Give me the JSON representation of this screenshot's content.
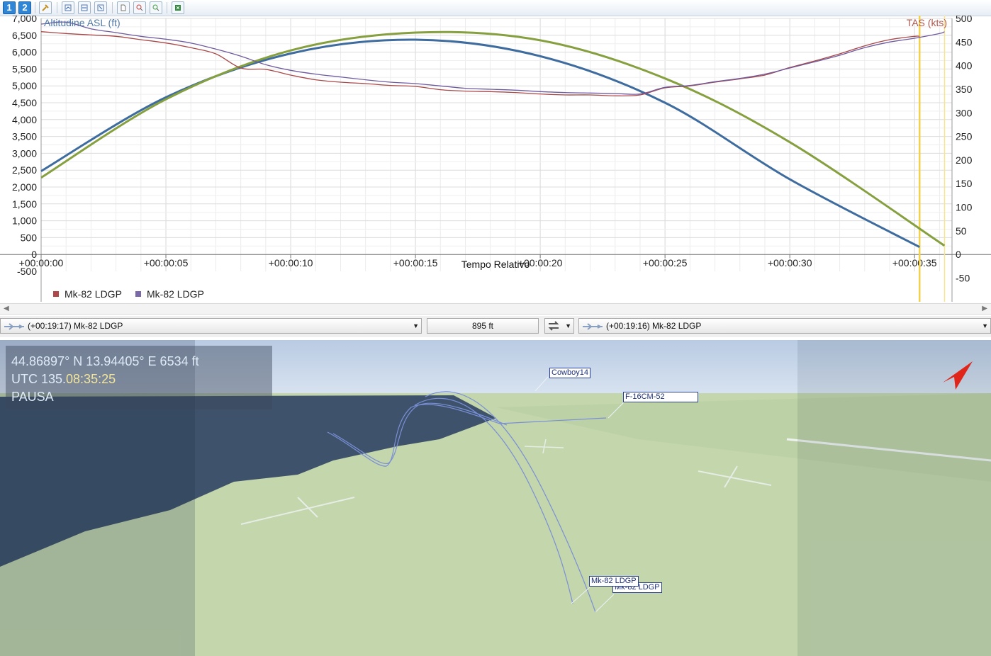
{
  "toolbar": {
    "tab1_label": "1",
    "tab2_label": "2",
    "icons": [
      "wrench-icon",
      "chart-add-icon",
      "chart-stack-icon",
      "chart-remove-icon",
      "new-page-icon",
      "zoom-out-icon",
      "zoom-in-icon",
      "export-excel-icon"
    ]
  },
  "chart": {
    "left_axis_title": "Altitudine ASL (ft)",
    "right_axis_title": "TAS (kts)",
    "x_axis_title": "Tempo Relativo",
    "legend": [
      {
        "label": "Mk-82 LDGP",
        "color": "#b04848"
      },
      {
        "label": "Mk-82 LDGP",
        "color": "#7a68a8"
      }
    ]
  },
  "chart_data": {
    "type": "line",
    "x_unit": "seconds (relative time)",
    "x_ticks": [
      "+00:00:00",
      "+00:00:05",
      "+00:00:10",
      "+00:00:15",
      "+00:00:20",
      "+00:00:25",
      "+00:00:30",
      "+00:00:35"
    ],
    "x_range": [
      0,
      36.5
    ],
    "y_left_range": [
      -500,
      7000
    ],
    "y_left_ticks": [
      "-500",
      "0",
      "500",
      "1,000",
      "1,500",
      "2,000",
      "2,500",
      "3,000",
      "3,500",
      "4,000",
      "4,500",
      "5,000",
      "5,500",
      "6,000",
      "6,500",
      "7,000"
    ],
    "y_right_range": [
      -50,
      500
    ],
    "y_right_ticks": [
      "-50",
      "0",
      "50",
      "100",
      "150",
      "200",
      "250",
      "300",
      "350",
      "400",
      "450",
      "500"
    ],
    "series": [
      {
        "name": "Altitudine ASL (ft)",
        "color": "#3f6c9e",
        "axis": "left",
        "x": [
          0,
          5,
          10,
          15,
          20,
          25,
          30,
          35.2
        ],
        "y": [
          2470,
          4660,
          5960,
          6370,
          5880,
          4500,
          2230,
          220
        ]
      },
      {
        "name": "Altitudine ASL (ft)",
        "color": "#86a040",
        "axis": "left",
        "x": [
          0,
          5,
          10,
          15,
          20,
          25,
          30,
          36.2
        ],
        "y": [
          2280,
          4600,
          6050,
          6580,
          6350,
          5220,
          3330,
          260
        ]
      },
      {
        "name": "TAS (kts)",
        "color": "#a84848",
        "axis": "right",
        "x": [
          0,
          1,
          2,
          3,
          4,
          5,
          6,
          7,
          8,
          9,
          10,
          11,
          12,
          13,
          14,
          15,
          16,
          17,
          18,
          19,
          20,
          21,
          22,
          23,
          24,
          25,
          26,
          27,
          28,
          29,
          30,
          31,
          32,
          33,
          34,
          35,
          35.2
        ],
        "y": [
          472,
          468,
          465,
          462,
          455,
          448,
          438,
          425,
          395,
          392,
          380,
          370,
          365,
          362,
          358,
          356,
          349,
          346,
          345,
          343,
          340,
          338,
          338,
          336,
          338,
          353,
          357,
          365,
          372,
          380,
          396,
          410,
          425,
          442,
          455,
          462,
          462
        ]
      },
      {
        "name": "TAS (kts)",
        "color": "#6f5a9e",
        "axis": "right",
        "x": [
          0,
          1,
          2,
          3,
          4,
          5,
          6,
          7,
          8,
          9,
          10,
          11,
          12,
          13,
          14,
          15,
          16,
          17,
          18,
          19,
          20,
          21,
          22,
          23,
          24,
          25,
          26,
          27,
          28,
          29,
          30,
          31,
          32,
          33,
          34,
          35,
          36,
          36.2
        ],
        "y": [
          488,
          492,
          478,
          470,
          462,
          456,
          448,
          435,
          420,
          402,
          390,
          382,
          376,
          370,
          365,
          362,
          357,
          352,
          350,
          348,
          345,
          343,
          342,
          341,
          340,
          354,
          358,
          366,
          373,
          382,
          395,
          408,
          422,
          438,
          450,
          458,
          468,
          472
        ]
      }
    ],
    "cursor_lines_s": [
      35.2,
      36.2
    ],
    "grid": true,
    "legend_position": "bottom-left"
  },
  "selectors": {
    "left_object": "(+00:19:17) Mk-82 LDGP",
    "distance": "895 ft",
    "right_object": "(+00:19:16) Mk-82 LDGP"
  },
  "hud": {
    "coords": "44.86897° N  13.94405° E  6534 ft",
    "utc_prefix": "UTC 135.",
    "utc_time": "08:35:25",
    "status": "PAUSA"
  },
  "labels3d": {
    "cowboy": "Cowboy14",
    "f16": "F-16CM-52",
    "bomb1": "Mk-82 LDGP",
    "bomb2": "Mk-82 LDGP"
  }
}
